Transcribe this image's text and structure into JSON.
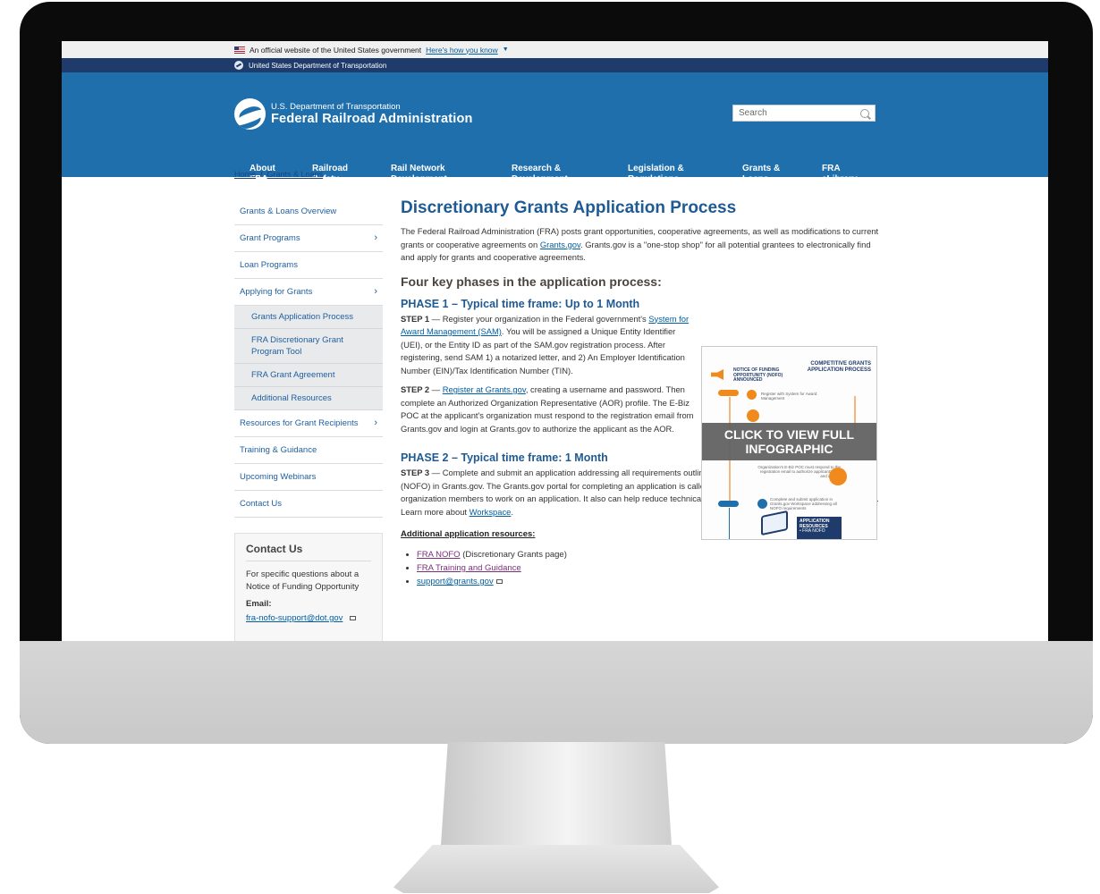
{
  "gov_banner": {
    "text": "An official website of the United States government",
    "link": "Here's how you know"
  },
  "dot_bar": {
    "text": "United States Department of Transportation"
  },
  "brand": {
    "line1": "U.S. Department of Transportation",
    "line2": "Federal Railroad Administration"
  },
  "search": {
    "placeholder": "Search"
  },
  "nav": [
    {
      "line1": "About",
      "line2": "FRA"
    },
    {
      "line1": "Railroad",
      "line2": "Safety"
    },
    {
      "line1": "Rail Network",
      "line2": "Development"
    },
    {
      "line1": "Research &",
      "line2": "Development"
    },
    {
      "line1": "Legislation &",
      "line2": "Regulations"
    },
    {
      "line1": "Grants &",
      "line2": "Loans"
    },
    {
      "line1": "FRA",
      "line2": "eLibrary"
    }
  ],
  "breadcrumb": {
    "home": "Home",
    "sep": "/",
    "current": "Grants & Loans"
  },
  "sidebar": {
    "items": [
      {
        "label": "Grants & Loans Overview",
        "chevron": ""
      },
      {
        "label": "Grant Programs",
        "chevron": "›"
      },
      {
        "label": "Loan Programs",
        "chevron": ""
      },
      {
        "label": "Applying for Grants",
        "chevron": "›"
      }
    ],
    "subitems": [
      "Grants Application Process",
      "FRA Discretionary Grant Program Tool",
      "FRA Grant Agreement",
      "Additional Resources"
    ],
    "items2": [
      {
        "label": "Resources for Grant Recipients",
        "chevron": "›"
      },
      {
        "label": "Training & Guidance",
        "chevron": ""
      },
      {
        "label": "Upcoming Webinars",
        "chevron": ""
      },
      {
        "label": "Contact Us",
        "chevron": ""
      }
    ]
  },
  "contact": {
    "title": "Contact Us",
    "text": "For specific questions about a Notice of Funding Opportunity",
    "email_label": "Email:",
    "email": "fra-nofo-support@dot.gov"
  },
  "main": {
    "title": "Discretionary Grants Application Process",
    "intro_a": "The Federal Railroad Administration (FRA) posts grant opportunities, cooperative agreements, as well as modifications to current grants or cooperative agreements on ",
    "intro_link": "Grants.gov",
    "intro_b": ". Grants.gov is a \"one-stop shop\" for all potential grantees to electronically find and apply for grants and cooperative agreements.",
    "phases_heading": "Four key phases in the application process:",
    "phase1_title": "PHASE 1 – Typical time frame: Up to 1 Month",
    "step1_label": "STEP 1",
    "step1_a": " — Register your organization in the Federal government's ",
    "step1_link": "System for Award Management (SAM)",
    "step1_b": ". You will be assigned a Unique Entity Identifier (UEI), or the Entity ID as part of the SAM.gov registration process. After registering, send SAM 1) a notarized letter, and 2) An Employer Identification Number (EIN)/Tax Identification Number (TIN).",
    "step2_label": "STEP 2",
    "step2_a": " — ",
    "step2_link": "Register at Grants.gov",
    "step2_b": ", creating a username and password. Then complete an Authorized Organization Representative (AOR) profile. The E-Biz POC at the applicant's organization must respond to the registration email from Grants.gov and login at Grants.gov to authorize the applicant as the AOR.",
    "phase2_title": "PHASE 2 – Typical time frame: 1 Month",
    "step3_label": "STEP 3",
    "step3_a": " — Complete and submit an application addressing all requirements outlined in the Notice of Funding Opportunity (NOFO) in Grants.gov. The Grants.gov portal for completing an application is called \"Workspace.\" It allows flexibility for multiple organization members to work on an application. It also can help reduce technical issues when you are submitting an application. Learn more about ",
    "step3_link": "Workspace",
    "step3_b": ".",
    "resources_heading": "Additional application resources:",
    "resources": [
      {
        "link": "FRA NOFO",
        "suffix": " (Discretionary Grants page)"
      },
      {
        "link": "FRA Training and Guidance",
        "suffix": ""
      },
      {
        "link": "support@grants.gov",
        "suffix": ""
      }
    ]
  },
  "infographic": {
    "header_line1": "COMPETITIVE GRANTS",
    "header_line2": "APPLICATION PROCESS",
    "nofo_line1": "NOTICE OF FUNDING",
    "nofo_line2": "OPPORTUNITY (NOFO)",
    "nofo_line3": "ANNOUNCED",
    "overlay_line1": "CLICK TO VIEW FULL",
    "overlay_line2": "INFOGRAPHIC",
    "step_a": "Register with System for Award Management",
    "step_b": "Organization's E-Biz POC must respond to the registration email to authorize applicant's role and access",
    "step_c": "Complete and submit application in Grants.gov Workspace addressing all NOFO requirements",
    "resources_title": "APPLICATION RESOURCES",
    "resources_item": "• FRA NOFO",
    "colors": {
      "orange": "#f18a1c",
      "navy": "#1f3b6b"
    }
  },
  "colors": {
    "header_blue": "#1f6fad",
    "dot_bar_navy": "#1f3b6b",
    "title_blue": "#1f5a92",
    "link_blue": "#005ea2"
  }
}
